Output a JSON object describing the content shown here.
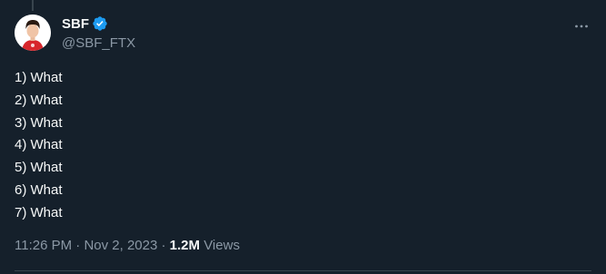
{
  "author": {
    "display_name": "SBF",
    "handle": "@SBF_FTX",
    "verified": true,
    "avatar_icon": "avatar-person-red-shirt"
  },
  "tweet": {
    "lines": [
      "1) What",
      "2) What",
      "3) What",
      "4) What",
      "5) What",
      "6) What",
      "7) What"
    ]
  },
  "meta": {
    "time": "11:26 PM",
    "separator": " · ",
    "date": "Nov 2, 2023",
    "views_count": "1.2M",
    "views_label": " Views"
  },
  "icons": {
    "verified": "verified-badge-icon",
    "more": "more-dots-icon"
  },
  "colors": {
    "background": "#15202b",
    "text_primary": "#f7f9f9",
    "text_secondary": "#8b98a5",
    "verified_blue": "#1d9bf0",
    "divider": "#38444d"
  }
}
